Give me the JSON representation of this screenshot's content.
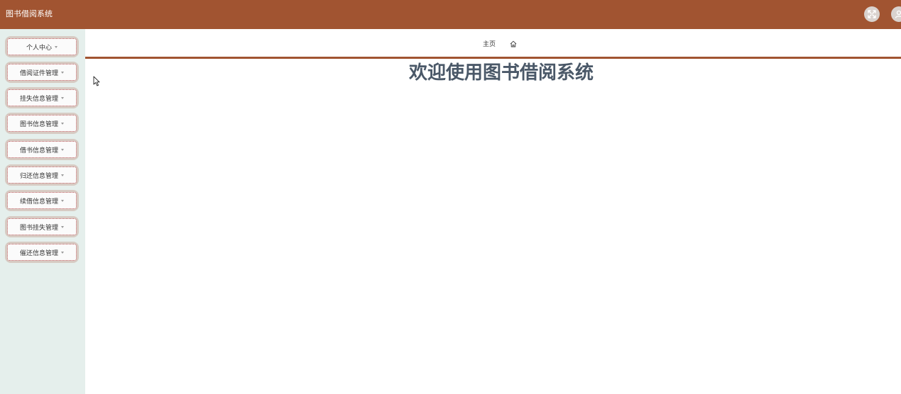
{
  "header": {
    "title": "图书借阅系统",
    "bg_color": "#a15431",
    "icons": [
      "fullscreen-icon",
      "user-icon"
    ]
  },
  "sidebar": {
    "bg_color": "#e5efec",
    "items": [
      {
        "label": "个人中心"
      },
      {
        "label": "借阅证件管理"
      },
      {
        "label": "挂失信息管理"
      },
      {
        "label": "图书信息管理"
      },
      {
        "label": "借书信息管理"
      },
      {
        "label": "归还信息管理"
      },
      {
        "label": "续借信息管理"
      },
      {
        "label": "图书挂失管理"
      },
      {
        "label": "催还信息管理"
      }
    ]
  },
  "breadcrumb": {
    "home_label": "主页",
    "icon": "home-icon"
  },
  "main": {
    "welcome": "欢迎使用图书借阅系统",
    "accent_color": "#a15431",
    "welcome_color": "#4a5868"
  }
}
